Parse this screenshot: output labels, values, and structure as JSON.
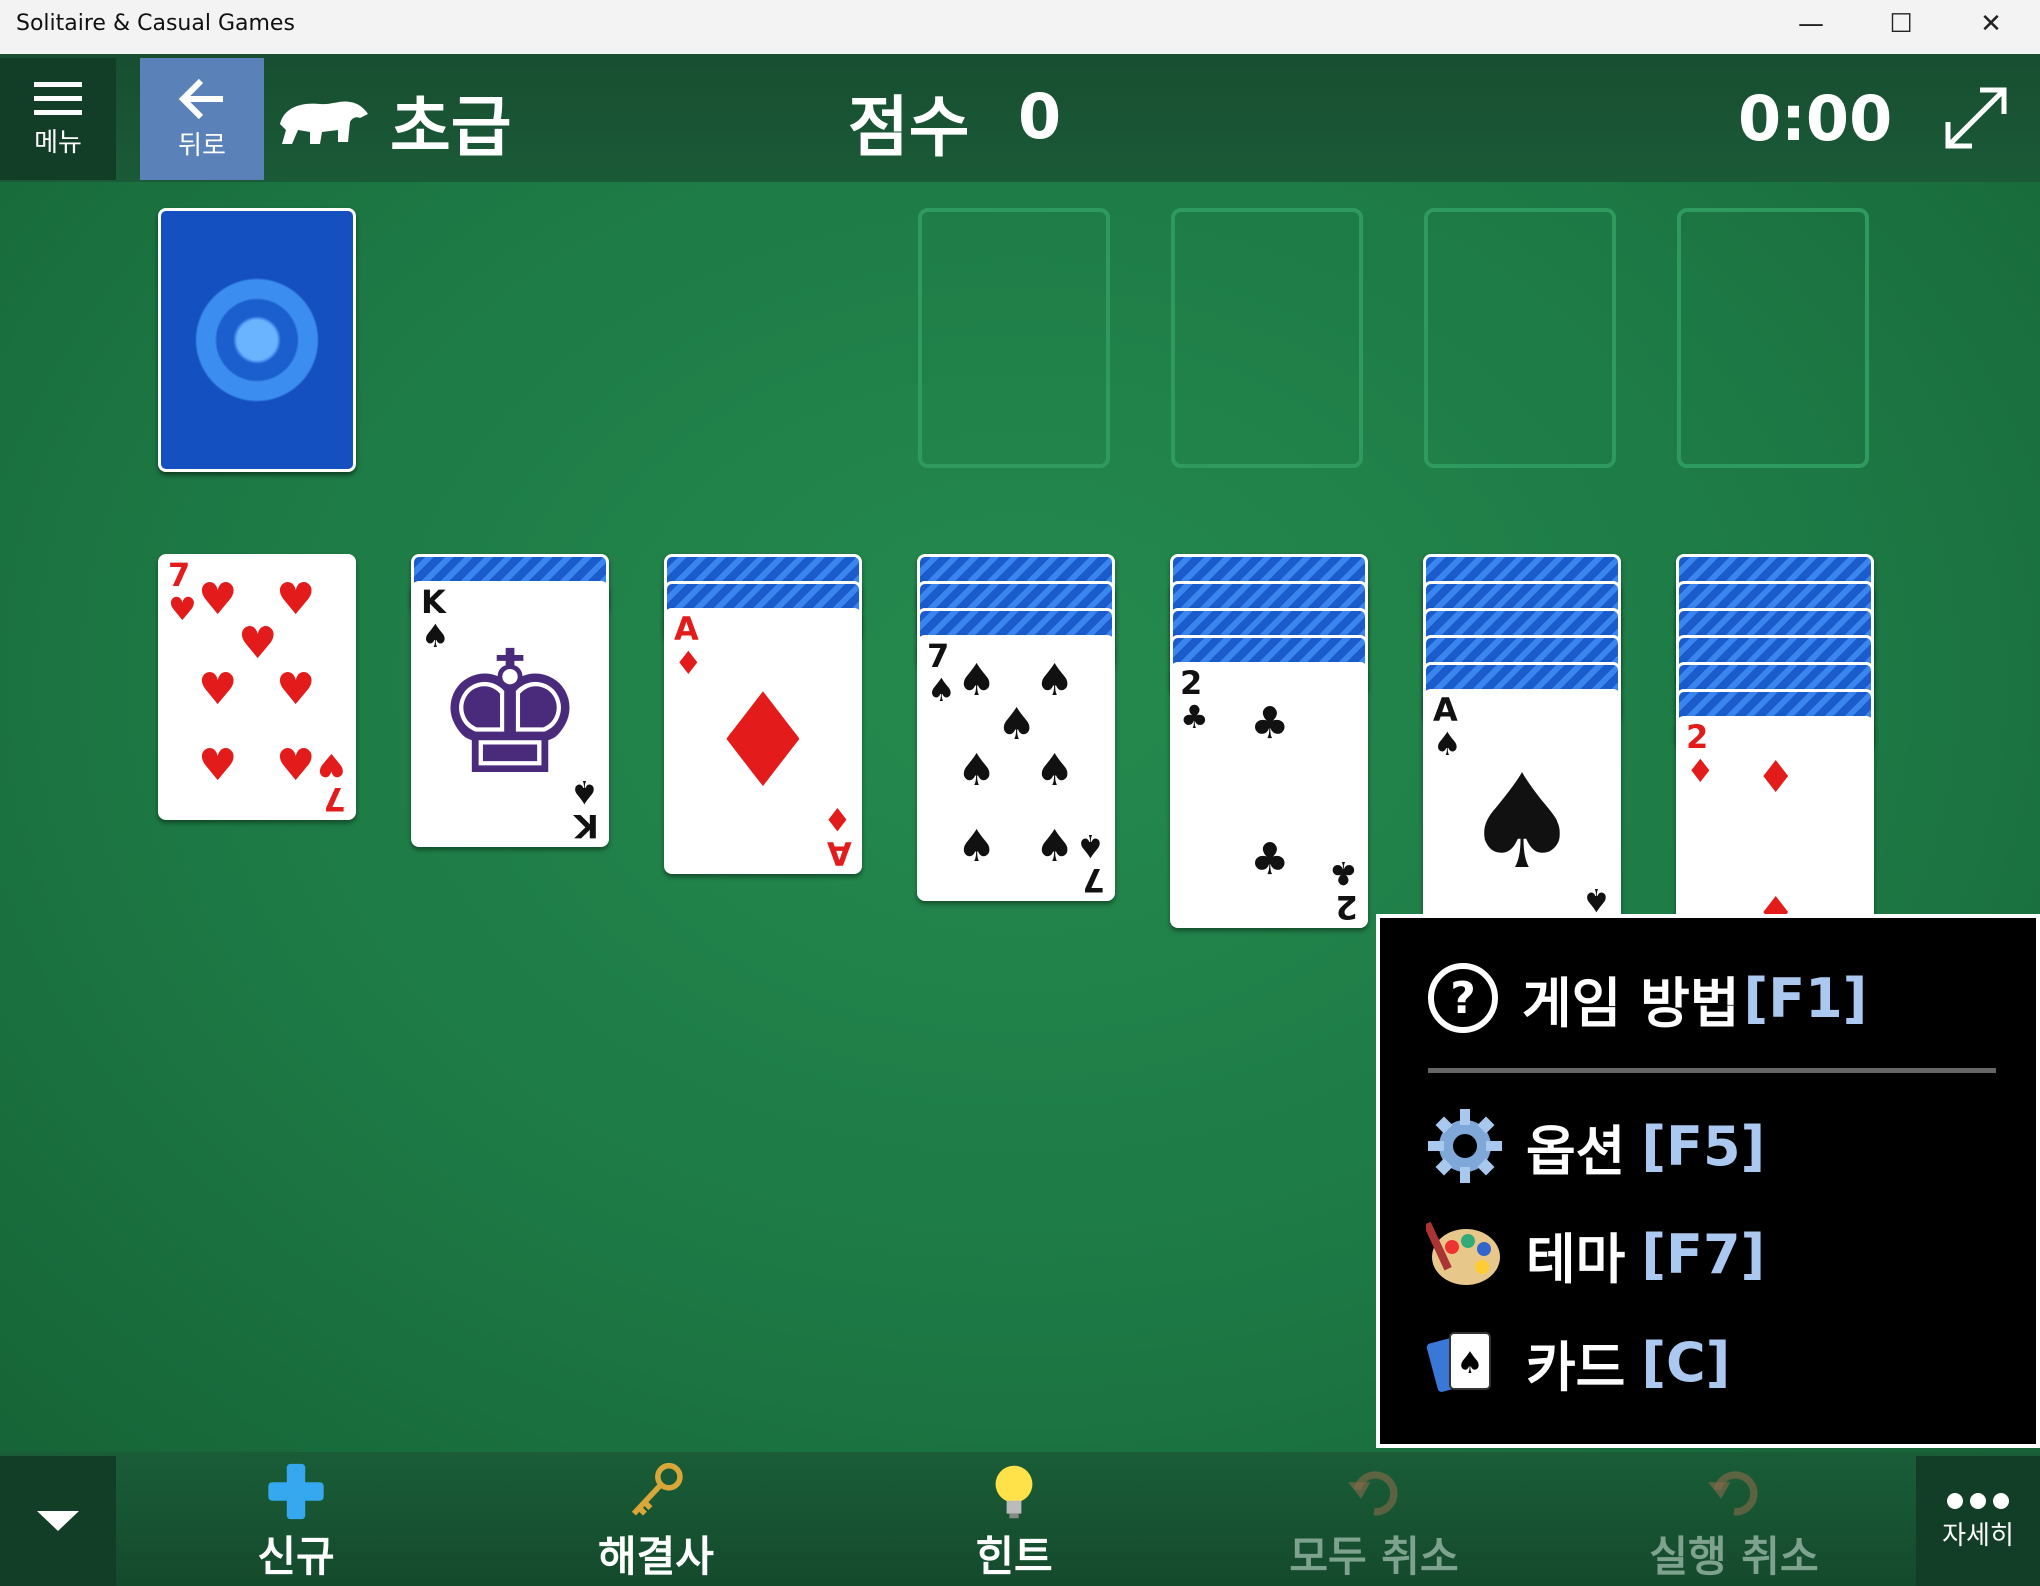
{
  "window": {
    "title": "Solitaire & Casual Games",
    "minimize": "—",
    "maximize": "☐",
    "close": "✕"
  },
  "header": {
    "menu_label": "메뉴",
    "back_label": "뒤로",
    "level": "초급",
    "score_label": "점수",
    "score_value": "0",
    "timer": "0:00"
  },
  "tableau": [
    {
      "face_down": 0,
      "rank": "7",
      "suit": "♥",
      "color": "red"
    },
    {
      "face_down": 1,
      "rank": "K",
      "suit": "♠",
      "color": "black"
    },
    {
      "face_down": 2,
      "rank": "A",
      "suit": "♦",
      "color": "red"
    },
    {
      "face_down": 3,
      "rank": "7",
      "suit": "♠",
      "color": "black"
    },
    {
      "face_down": 4,
      "rank": "2",
      "suit": "♣",
      "color": "black"
    },
    {
      "face_down": 5,
      "rank": "A",
      "suit": "♠",
      "color": "black"
    },
    {
      "face_down": 6,
      "rank": "2",
      "suit": "♦",
      "color": "red"
    }
  ],
  "popup_menu": [
    {
      "label": "게임 방법",
      "key": "[F1]",
      "icon": "help-icon"
    },
    {
      "label": "옵션",
      "key": "[F5]",
      "icon": "gear-icon"
    },
    {
      "label": "테마",
      "key": "[F7]",
      "icon": "palette-icon"
    },
    {
      "label": "카드",
      "key": "[C]",
      "icon": "cards-icon"
    }
  ],
  "toolbar": {
    "new_label": "신규",
    "solver_label": "해결사",
    "hint_label": "힌트",
    "undo_all_label": "모두 취소",
    "undo_label": "실행 취소",
    "more_label": "자세히"
  },
  "colors": {
    "felt": "#1d7a45",
    "card_back": "#1b5fcf",
    "red_suit": "#e41b1b"
  }
}
